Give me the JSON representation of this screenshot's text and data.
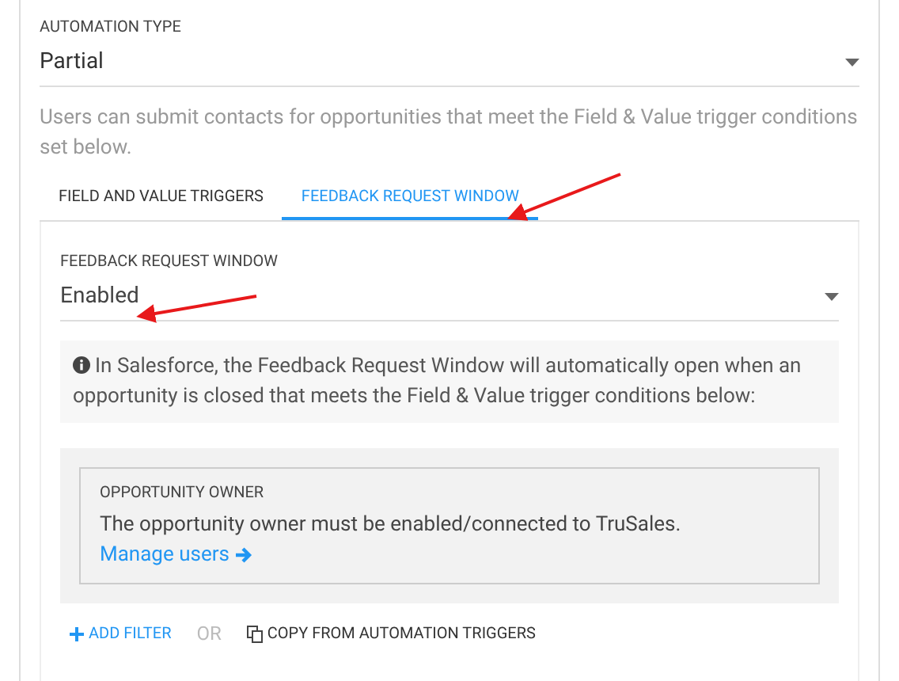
{
  "automation_type": {
    "label": "AUTOMATION TYPE",
    "value": "Partial"
  },
  "description": "Users can submit contacts for opportunities that meet the Field & Value trigger conditions set below.",
  "tabs": [
    {
      "label": "FIELD AND VALUE TRIGGERS",
      "selected": false
    },
    {
      "label": "FEEDBACK REQUEST WINDOW",
      "selected": true
    }
  ],
  "feedback_window": {
    "label": "FEEDBACK REQUEST WINDOW",
    "value": "Enabled"
  },
  "info": "In Salesforce, the Feedback Request Window will automatically open when an opportunity is closed that meets the Field & Value trigger conditions below:",
  "filter": {
    "title": "OPPORTUNITY OWNER",
    "text": "The opportunity owner must be enabled/connected to TruSales.",
    "link": "Manage users"
  },
  "actions": {
    "add": "ADD FILTER",
    "or": "OR",
    "copy": "COPY FROM AUTOMATION TRIGGERS"
  }
}
